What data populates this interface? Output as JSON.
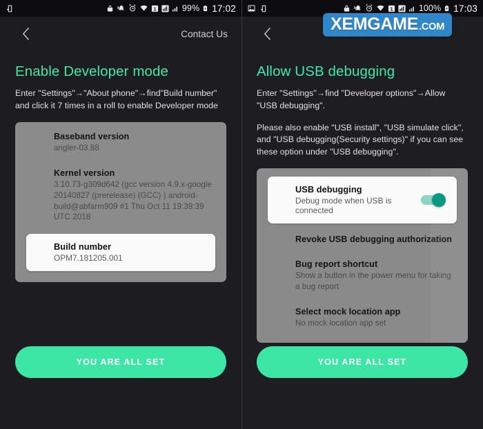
{
  "watermark": {
    "main": "XEMGAME",
    "tld": ".COM",
    "color": "#2f86c8"
  },
  "theme": {
    "background": "#1e1e22",
    "accent_green": "#3de9a8",
    "cta_green": "#3ce6a5",
    "card_grey": "#8b8b8b",
    "toggle_on": "#089b7f"
  },
  "left_panel": {
    "statusbar": {
      "left_icons": [
        "usb-device-icon"
      ],
      "right_icons": [
        "lock-icon",
        "bell-muted-icon",
        "alarm-clock-icon",
        "wifi-icon",
        "sim-1-icon",
        "signal-bars-icon",
        "signal-bars-secondary-icon"
      ],
      "battery_percent": "99%",
      "battery_icon": "battery-charging-icon",
      "clock": "17:02"
    },
    "navbar": {
      "back_icon": "chevron-left-icon",
      "action_label": "Contact Us"
    },
    "heading": "Enable Developer mode",
    "paragraphs": [
      "Enter \"Settings\"→\"About phone\"→find\"Build number\" and click it 7 times in a roll to enable Developer mode"
    ],
    "card_rows": [
      {
        "title": "Baseband version",
        "subtitle": "angler-03.88"
      },
      {
        "title": "Kernel version",
        "subtitle": "3.10.73-g309d642 (gcc version 4.9.x-google 20140827 (prerelease) (GCC) ) android-build@abfarm909 #1 Thu Oct 11 19:39:39 UTC 2018"
      }
    ],
    "highlight_row": {
      "title": "Build number",
      "subtitle": "OPM7.181205.001"
    },
    "cta_label": "YOU ARE ALL SET"
  },
  "right_panel": {
    "statusbar": {
      "left_icons": [
        "image-icon",
        "usb-device-icon"
      ],
      "right_icons": [
        "lock-icon",
        "bell-muted-icon",
        "alarm-clock-icon",
        "wifi-icon",
        "sim-1-icon",
        "signal-bars-icon",
        "signal-bars-secondary-icon"
      ],
      "battery_percent": "100%",
      "battery_icon": "battery-charging-icon",
      "clock": "17:03"
    },
    "navbar": {
      "back_icon": "chevron-left-icon",
      "action_label": ""
    },
    "heading": "Allow USB debugging",
    "paragraphs": [
      "Enter \"Settings\"→find \"Developer options\"→Allow \"USB debugging\".",
      "Please also enable \"USB install\", \"USB simulate click\", and \"USB debugging(Security settings)\" if you can see these option under \"USB debugging\"."
    ],
    "highlight_row": {
      "title": "USB debugging",
      "subtitle": "Debug mode when USB is connected",
      "toggle_state": "on"
    },
    "card_rows": [
      {
        "title": "Revoke USB debugging authorization",
        "subtitle": ""
      },
      {
        "title": "Bug report shortcut",
        "subtitle": "Show a button in the power menu for taking a bug report"
      },
      {
        "title": "Select mock location app",
        "subtitle": "No mock location app set"
      }
    ],
    "cta_label": "YOU ARE ALL SET"
  }
}
